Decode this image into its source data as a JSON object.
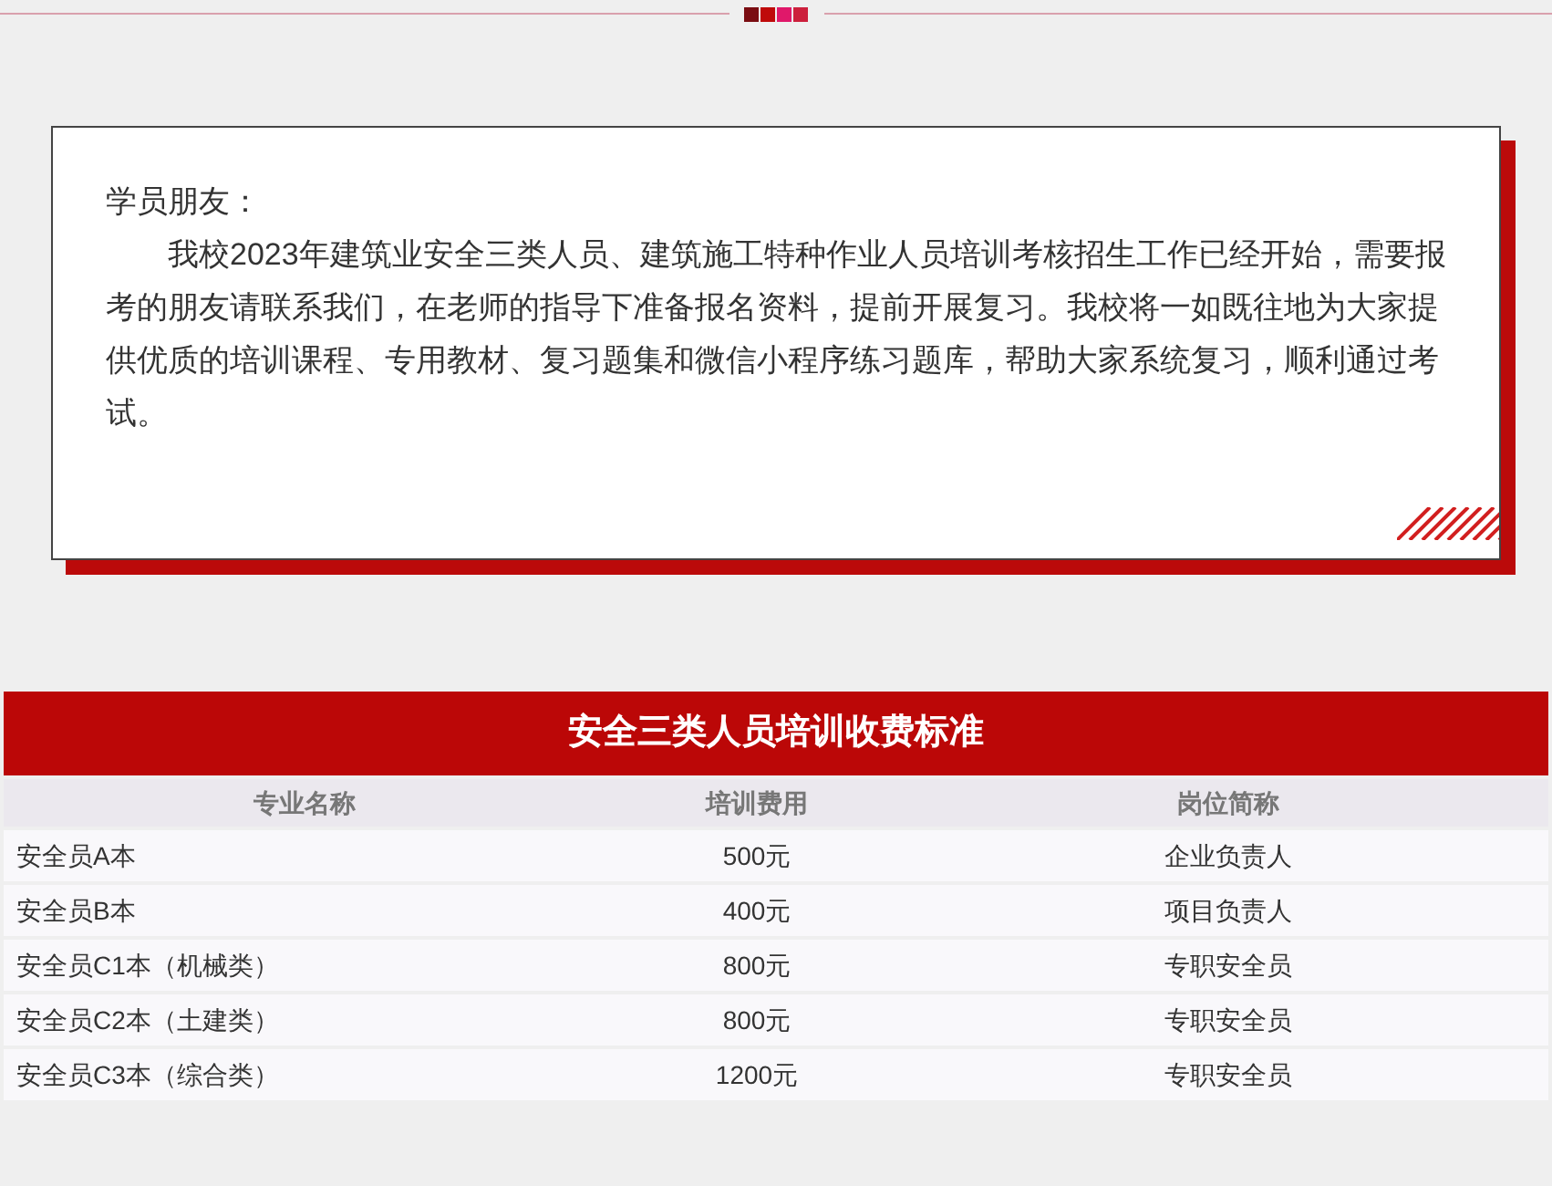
{
  "notice": {
    "greeting": "学员朋友：",
    "body": "我校2023年建筑业安全三类人员、建筑施工特种作业人员培训考核招生工作已经开始，需要报考的朋友请联系我们，在老师的指导下准备报名资料，提前开展复习。我校将一如既往地为大家提供优质的培训课程、专用教材、复习题集和微信小程序练习题库，帮助大家系统复习，顺利通过考试。"
  },
  "table": {
    "title": "安全三类人员培训收费标准",
    "columns": [
      "专业名称",
      "培训费用",
      "岗位简称"
    ],
    "rows": [
      [
        "安全员A本",
        "500元",
        "企业负责人"
      ],
      [
        "安全员B本",
        "400元",
        "项目负责人"
      ],
      [
        "安全员C1本（机械类）",
        "800元",
        "专职安全员"
      ],
      [
        "安全员C2本（土建类）",
        "800元",
        "专职安全员"
      ],
      [
        "安全员C3本（综合类）",
        "1200元",
        "专职安全员"
      ]
    ]
  }
}
